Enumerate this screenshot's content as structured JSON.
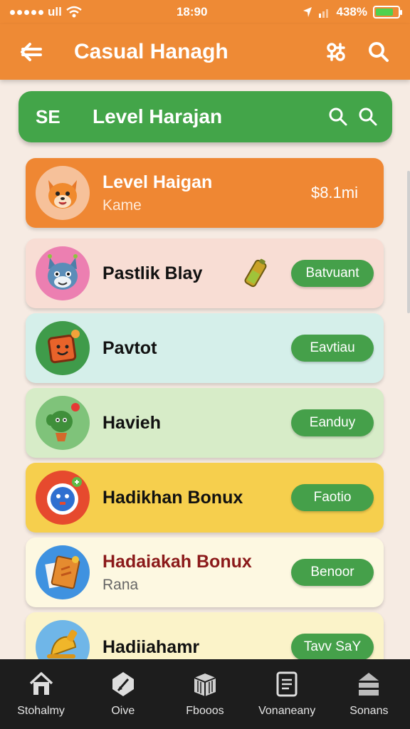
{
  "status_bar": {
    "carrier": "ull",
    "time": "18:90",
    "battery": "438%"
  },
  "app_bar": {
    "title": "Casual Hanagh",
    "back_icon": "back-arrow-icon",
    "actions": [
      "puzzle-icon",
      "search-icon"
    ]
  },
  "search": {
    "badge": "SE",
    "text": "Level Harajan",
    "icons": [
      "search-icon",
      "search-icon"
    ]
  },
  "items": [
    {
      "title": "Level Haigan",
      "subtitle": "Kame",
      "value": "$8.1mi",
      "bg": "#ef8733",
      "title_color": "#ffffff",
      "sub_color": "#ffe9d6",
      "avatar": "fox-avatar-icon"
    },
    {
      "title": "Pastlik Blay",
      "button": "Batvuant",
      "bg": "#f8ddd4",
      "avatar": "cat-avatar-icon",
      "extra": "battery-icon"
    },
    {
      "title": "Pavtot",
      "button": "Eavtiau",
      "bg": "#d5efea",
      "avatar": "box-avatar-icon"
    },
    {
      "title": "Havieh",
      "button": "Eanduy",
      "bg": "#d7ecc8",
      "avatar": "cactus-avatar-icon"
    },
    {
      "title": "Hadikhan Bonux",
      "button": "Faotio",
      "bg": "#f6cf4d",
      "avatar": "robot-avatar-icon"
    },
    {
      "title": "Hadaiakah Bonux",
      "subtitle": "Rana",
      "button": "Benoor",
      "bg": "#fdf8e1",
      "title_color": "#8b1a1a",
      "avatar": "book-avatar-icon"
    },
    {
      "title": "Hadiiahamr",
      "button": "Tavv SaY",
      "bg": "#fbf3c9",
      "avatar": "bell-avatar-icon"
    }
  ],
  "nav": [
    {
      "label": "Stohalmy",
      "icon": "home-icon"
    },
    {
      "label": "Oive",
      "icon": "pen-icon"
    },
    {
      "label": "Fbooos",
      "icon": "cube-icon"
    },
    {
      "label": "Vonaneany",
      "icon": "document-icon"
    },
    {
      "label": "Sonans",
      "icon": "stack-icon"
    }
  ]
}
